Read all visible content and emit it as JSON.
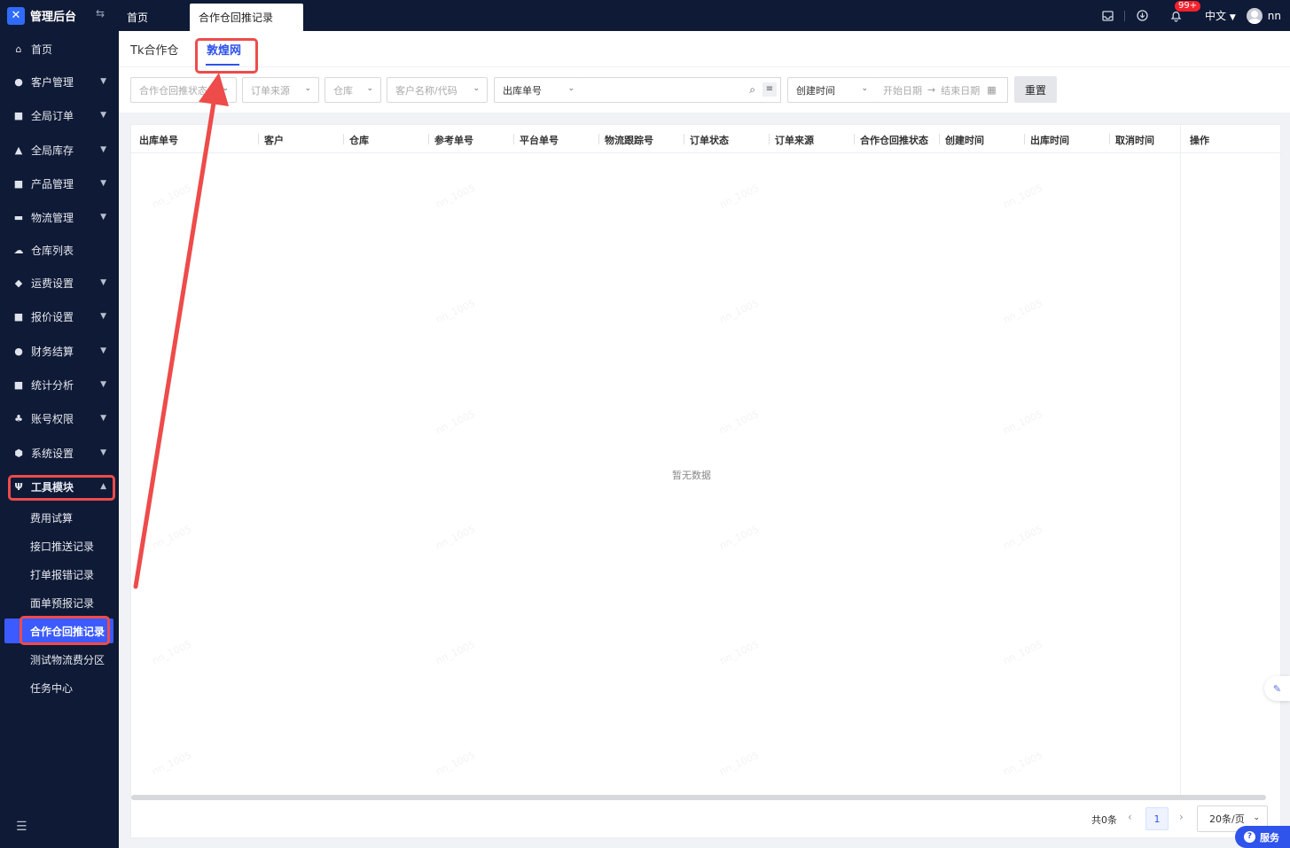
{
  "app": {
    "title": "管理后台"
  },
  "topbar": {
    "tabs": [
      {
        "label": "首页"
      },
      {
        "label": "合作仓回推记录"
      }
    ],
    "badge": "99+",
    "lang": "中文",
    "user": "nn"
  },
  "sidebar": {
    "items": [
      {
        "label": "首页",
        "icon": "home-icon"
      },
      {
        "label": "客户管理",
        "icon": "users-icon"
      },
      {
        "label": "全局订单",
        "icon": "order-icon"
      },
      {
        "label": "全局库存",
        "icon": "inventory-icon"
      },
      {
        "label": "产品管理",
        "icon": "product-icon"
      },
      {
        "label": "物流管理",
        "icon": "truck-icon"
      },
      {
        "label": "仓库列表",
        "icon": "warehouse-icon"
      },
      {
        "label": "运费设置",
        "icon": "freight-icon"
      },
      {
        "label": "报价设置",
        "icon": "quote-icon"
      },
      {
        "label": "财务结算",
        "icon": "finance-icon"
      },
      {
        "label": "统计分析",
        "icon": "stats-icon"
      },
      {
        "label": "账号权限",
        "icon": "org-icon"
      },
      {
        "label": "系统设置",
        "icon": "settings-icon"
      },
      {
        "label": "工具模块",
        "icon": "tool-icon"
      }
    ],
    "subitems": [
      {
        "label": "费用试算"
      },
      {
        "label": "接口推送记录"
      },
      {
        "label": "打单报错记录"
      },
      {
        "label": "面单预报记录"
      },
      {
        "label": "合作仓回推记录"
      },
      {
        "label": "测试物流费分区"
      },
      {
        "label": "任务中心"
      }
    ]
  },
  "subtabs": [
    {
      "label": "Tk合作仓"
    },
    {
      "label": "敦煌网"
    }
  ],
  "filters": {
    "status_placeholder": "合作仓回推状态",
    "source_placeholder": "订单来源",
    "warehouse_placeholder": "仓库",
    "customer_placeholder": "客户名称/代码",
    "search_type": "出库单号",
    "date_type": "创建时间",
    "start_placeholder": "开始日期",
    "end_placeholder": "结束日期",
    "reset_label": "重置"
  },
  "table": {
    "columns": [
      "出库单号",
      "客户",
      "仓库",
      "参考单号",
      "平台单号",
      "物流跟踪号",
      "订单状态",
      "订单来源",
      "合作仓回推状态",
      "创建时间",
      "出库时间",
      "取消时间",
      "操作"
    ],
    "empty_text": "暂无数据"
  },
  "pager": {
    "total": "共0条",
    "current_page": "1",
    "page_size": "20条/页"
  },
  "service": {
    "label": "服务"
  },
  "watermark_text": "nn_1005",
  "colors": {
    "sidebar_bg": "#0f1a36",
    "accent": "#2f54eb",
    "annotation": "#ee4b4b"
  }
}
